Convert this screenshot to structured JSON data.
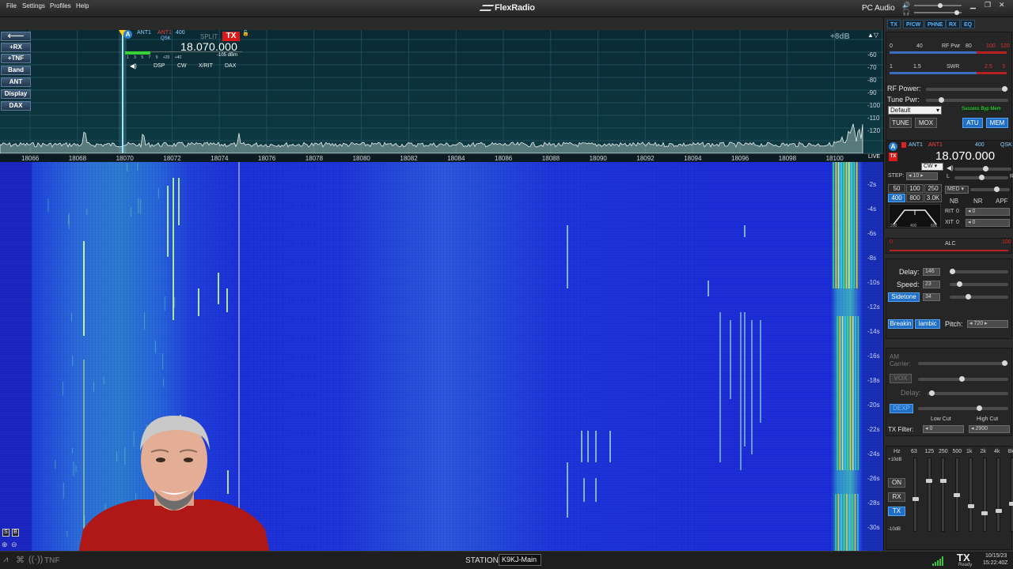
{
  "menu": {
    "file": "File",
    "settings": "Settings",
    "profiles": "Profiles",
    "help": "Help"
  },
  "app": {
    "title": "FlexRadio"
  },
  "audio": {
    "label": "PC Audio"
  },
  "left_buttons": [
    "+RX",
    "+TNF",
    "Band",
    "ANT",
    "Display",
    "DAX"
  ],
  "slice": {
    "letter": "A",
    "rx_ant": "ANT1",
    "tx_ant": "ANT1",
    "bandwidth": "400",
    "split": "SPLIT",
    "tx": "TX",
    "mode_line": "QSK",
    "frequency": "18.070.000",
    "meter_scale": "1 3 5 7 9 +20 +40",
    "signal": "-105 dBm",
    "tabs": [
      "DSP",
      "CW",
      "X/RIT",
      "DAX"
    ]
  },
  "pan": {
    "gain": "+8dB",
    "db_labels": [
      "-60",
      "-70",
      "-80",
      "-90",
      "-100",
      "-110",
      "-120"
    ]
  },
  "freq_axis": {
    "labels": [
      "18066",
      "18068",
      "18070",
      "18072",
      "18074",
      "18076",
      "18078",
      "18080",
      "18082",
      "18084",
      "18086",
      "18088",
      "18090",
      "18092",
      "18094",
      "18096",
      "18098",
      "18100"
    ],
    "live": "LIVE"
  },
  "wf_times": [
    "-2s",
    "-4s",
    "-6s",
    "-8s",
    "-10s",
    "-12s",
    "-14s",
    "-16s",
    "-18s",
    "-20s",
    "-22s",
    "-24s",
    "-26s",
    "-28s",
    "-30s"
  ],
  "right_tabs": [
    "TX",
    "P/CW",
    "PHNE",
    "RX",
    "EQ"
  ],
  "tx_meter": {
    "rf_scale": [
      "0",
      "40",
      "RF Pwr",
      "80",
      "100",
      "120"
    ],
    "swr_scale": [
      "1",
      "1.5",
      "SWR",
      "2.5",
      "3"
    ],
    "rf_power": "RF Power:",
    "tune_pwr": "Tune Pwr:",
    "profile": "Default",
    "atu_status": "Success Byp Mem",
    "tune": "TUNE",
    "mox": "MOX",
    "atu": "ATU",
    "mem": "MEM"
  },
  "rx_panel": {
    "letter": "A",
    "ant1": "ANT1",
    "ant2": "ANT1",
    "bw": "400",
    "qsk": "QSK",
    "frequency": "18.070.000",
    "step_label": "STEP:",
    "step": "10",
    "mode": "CW",
    "bw_buttons": [
      "50",
      "100",
      "250",
      "400",
      "800",
      "3.0K"
    ],
    "agc": "MED",
    "l": "L",
    "r": "R",
    "nb": "NB",
    "nr": "NR",
    "apf": "APF",
    "rit": "RIT",
    "xit": "XIT",
    "rit_val": "0",
    "xit_val": "0",
    "filter_scale": [
      "200",
      "400",
      "600"
    ]
  },
  "alc": {
    "label": "ALC",
    "min": "0",
    "max": "100"
  },
  "cw": {
    "delay_label": "Delay:",
    "delay": "146",
    "speed_label": "Speed:",
    "speed": "23",
    "sidetone": "Sidetone",
    "sidetone_val": "34",
    "breakin": "Breakin",
    "iambic": "Iambic",
    "pitch_label": "Pitch:",
    "pitch": "720"
  },
  "phone": {
    "am_carrier": "AM Carrier:",
    "vox": "VOX",
    "delay": "Delay:",
    "dexp": "DEXP",
    "low_cut": "Low Cut",
    "high_cut": "High Cut",
    "tx_filter": "TX Filter:",
    "low": "0",
    "high": "2900"
  },
  "eq": {
    "hz": "Hz",
    "bands": [
      "63",
      "125",
      "250",
      "500",
      "1k",
      "2k",
      "4k",
      "8k"
    ],
    "top": "+10dB",
    "bottom": "-10dB",
    "on": "ON",
    "rx": "RX",
    "tx": "TX",
    "levels": [
      0.55,
      0.3,
      0.3,
      0.5,
      0.65,
      0.75,
      0.72,
      0.62
    ]
  },
  "bottom": {
    "station_label": "STATION:",
    "station": "K9KJ-Main",
    "tnf": "TNF",
    "tx": "TX",
    "ready": "Ready",
    "date": "10/15/23",
    "time": "15:22:40Z",
    "s_btn": "S",
    "b_btn": "B"
  },
  "colors": {
    "accent": "#1f6fc7",
    "tx_red": "#e02020",
    "freq_white": "#ffffff",
    "waterfall": "#1b2bd6"
  }
}
